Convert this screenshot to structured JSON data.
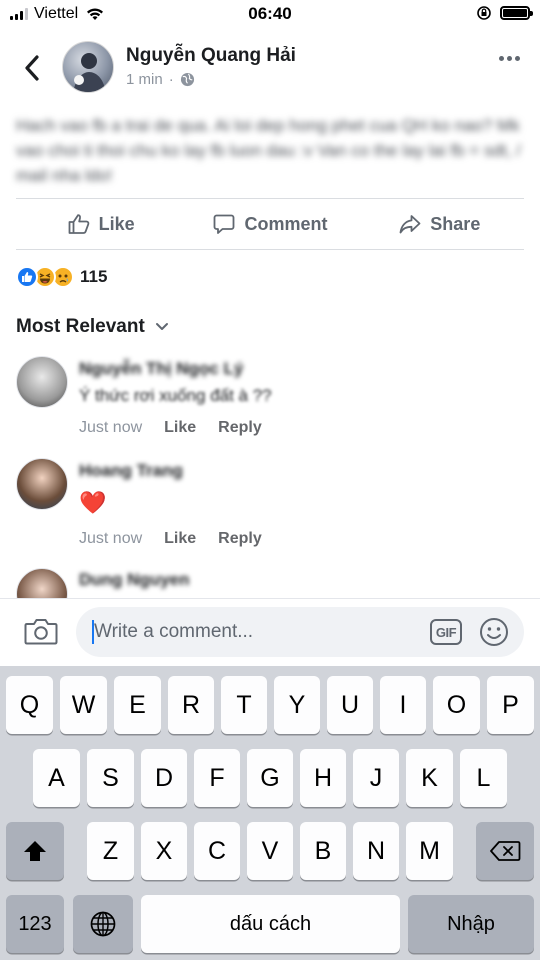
{
  "status_bar": {
    "carrier": "Viettel",
    "time": "06:40",
    "icons": [
      "signal-icon",
      "wifi-icon",
      "orientation-lock-icon",
      "battery-icon"
    ]
  },
  "post": {
    "author": "Nguyễn Quang Hải",
    "time_ago": "1 min",
    "audience_icon": "globe-icon",
    "text": "Hach vao fb a trai de qua. Ai loi dep hong phet cua QH ko nao? Mk vao choi ti thoi chu ko lay fb luon dau :v Van co the lay lai fb = sdt, / mail nha ldo!"
  },
  "actions": {
    "like": "Like",
    "comment": "Comment",
    "share": "Share"
  },
  "reactions": {
    "count": "115",
    "types": [
      "like-reaction-icon",
      "haha-reaction-icon",
      "sad-reaction-icon"
    ]
  },
  "sort": {
    "label": "Most Relevant"
  },
  "comments": [
    {
      "name": "Nguyễn Thị Ngọc Lý",
      "text": "Ý thức rơi xuống đất à ??",
      "time": "Just now",
      "like_label": "Like",
      "reply_label": "Reply"
    },
    {
      "name": "Hoang Trang",
      "text": "❤️",
      "time": "Just now",
      "like_label": "Like",
      "reply_label": "Reply"
    },
    {
      "name": "Dung Nguyen"
    }
  ],
  "composer": {
    "placeholder": "Write a comment...",
    "gif_label": "GIF"
  },
  "keyboard": {
    "row1": [
      "Q",
      "W",
      "E",
      "R",
      "T",
      "Y",
      "U",
      "I",
      "O",
      "P"
    ],
    "row2": [
      "A",
      "S",
      "D",
      "F",
      "G",
      "H",
      "J",
      "K",
      "L"
    ],
    "row3": [
      "Z",
      "X",
      "C",
      "V",
      "B",
      "N",
      "M"
    ],
    "numbers_label": "123",
    "space_label": "dấu cách",
    "return_label": "Nhập"
  },
  "colors": {
    "facebook_blue": "#1877f2",
    "keyboard_bg": "#d1d4da",
    "secondary_text": "#606770"
  }
}
